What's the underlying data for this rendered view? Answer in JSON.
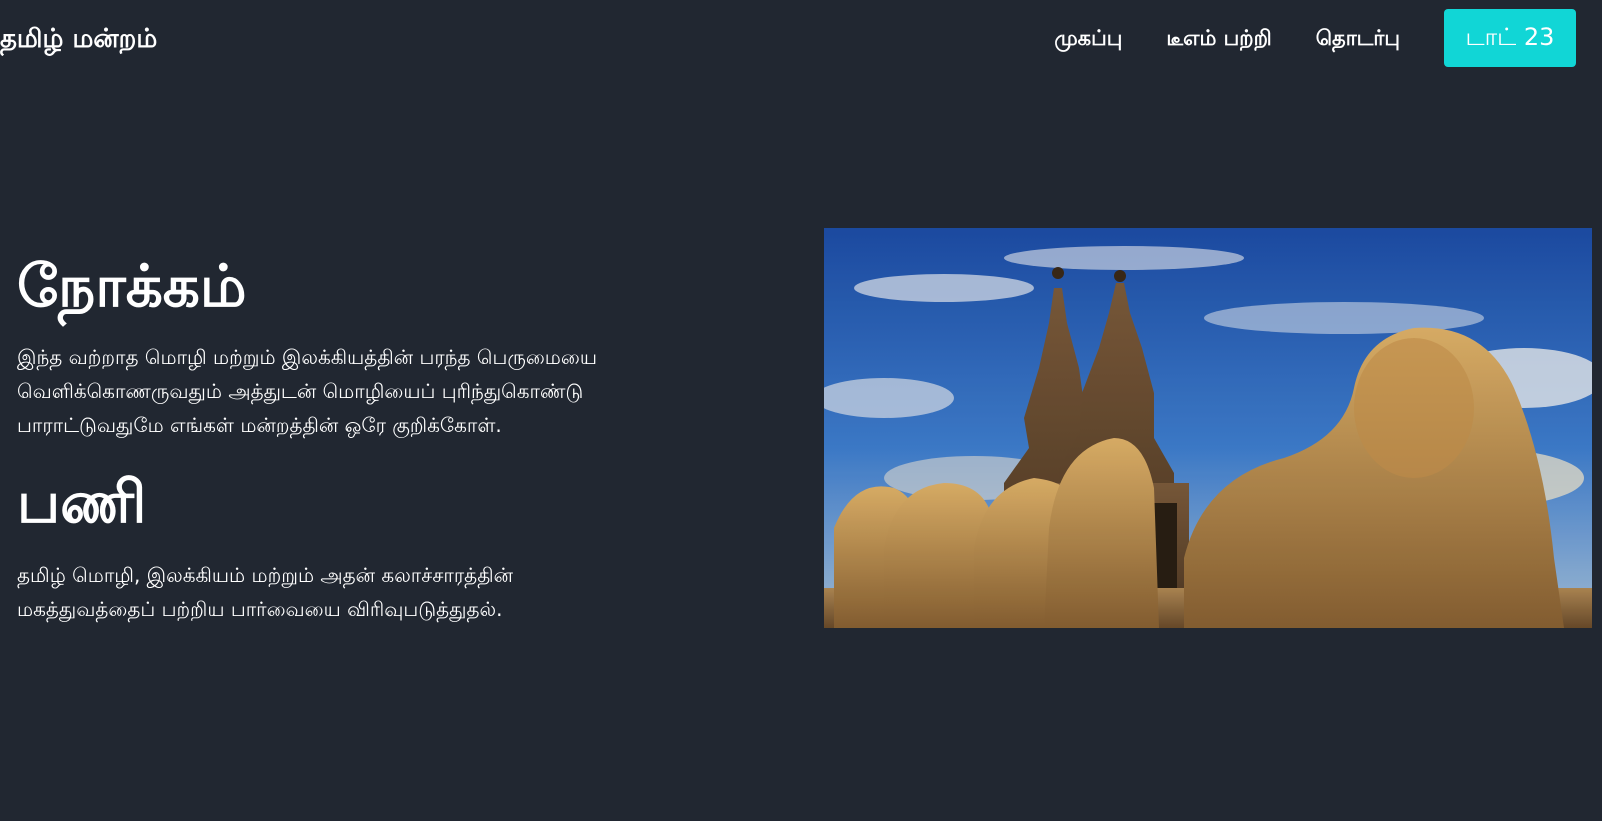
{
  "brand": "தமிழ் மன்றம்",
  "nav": {
    "items": [
      {
        "label": "முகப்பு",
        "name": "nav-home"
      },
      {
        "label": "டீஎம் பற்றி",
        "name": "nav-about"
      },
      {
        "label": "தொடர்பு",
        "name": "nav-contact"
      }
    ],
    "cta_label": "டாட் 23"
  },
  "main": {
    "section1_title": "நோக்கம்",
    "section1_text": "இந்த வற்றாத மொழி மற்றும் இலக்கியத்தின் பரந்த பெருமையை\nவெளிக்கொணருவதும் அத்துடன் மொழியைப் புரிந்துகொண்டு\nபாராட்டுவதுமே எங்கள் மன்றத்தின் ஒரே குறிக்கோள்.",
    "section2_title": "பணி",
    "section2_text": "தமிழ் மொழி, இலக்கியம் மற்றும் அதன் கலாச்சாரத்தின்\nமகத்துவத்தைப் பற்றிய பார்வையை விரிவுபடுத்துதல்."
  },
  "colors": {
    "background": "#212731",
    "cta": "#11d6d6",
    "text": "#ffffff"
  },
  "hero_image": {
    "description_icon": "temple-photo"
  }
}
